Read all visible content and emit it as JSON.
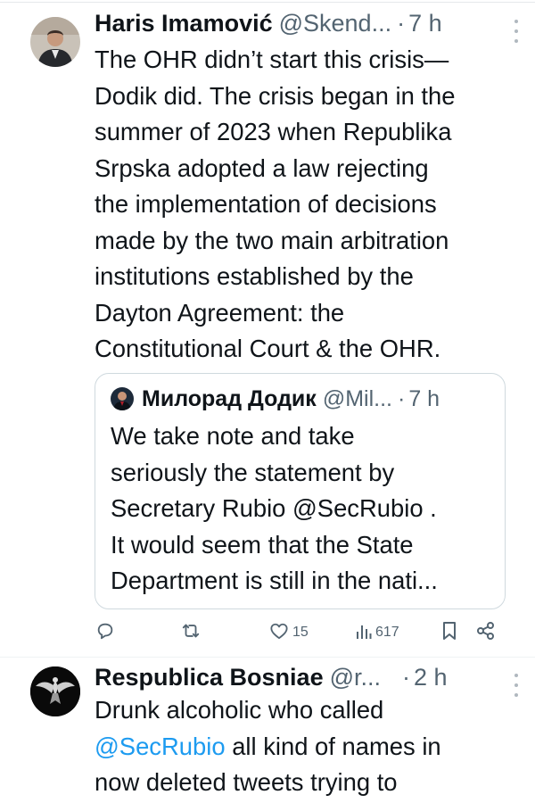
{
  "tweet": {
    "display_name": "Haris Imamović",
    "handle": "@Skend...",
    "separator": "·",
    "time": "7 h",
    "text": "The OHR didn’t start this crisis—\nDodik did. The crisis began in the\nsummer of 2023 when Republika\nSrpska adopted a law rejecting\nthe implementation of decisions\nmade by the two main arbitration\ninstitutions established by the\nDayton Agreement: the\nConstitutional Court & the OHR.",
    "quote": {
      "display_name": "Милорад Додик",
      "handle": "@Mil...",
      "separator": "·",
      "time": "7 h",
      "text": "We take note and take\nseriously the statement by\nSecretary Rubio @SecRubio .\nIt would seem that the State\nDepartment is still in the nati..."
    },
    "actions": {
      "reply_count": "",
      "retweet_count": "",
      "like_count": "15",
      "views_count": "617"
    }
  },
  "tweet2": {
    "display_name": "Respublica Bosniae",
    "handle": "@r...",
    "separator": "·",
    "time": "2 h",
    "text_line1": "Drunk alcoholic who called",
    "mention": "@SecRubio",
    "text_line2_rest": " all kind of names in",
    "text_line3": "now deleted tweets trying to"
  },
  "colors": {
    "text": "#0f1419",
    "secondary": "#536471",
    "link": "#1d9bf0",
    "border": "#cfd9de"
  },
  "icons": [
    "more-icon",
    "reply-icon",
    "retweet-icon",
    "like-icon",
    "views-icon",
    "bookmark-icon",
    "share-icon"
  ]
}
